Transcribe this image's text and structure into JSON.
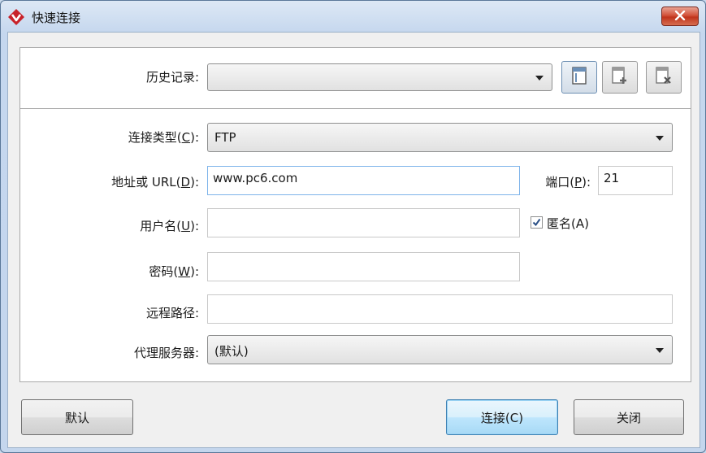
{
  "window": {
    "title": "快速连接",
    "icons": {
      "app": "app-logo-icon",
      "close": "close-icon"
    }
  },
  "history": {
    "label": "历史记录:",
    "value": "",
    "toolbar": {
      "icons": [
        "history-panel-icon",
        "add-history-icon",
        "delete-history-icon"
      ]
    }
  },
  "form": {
    "conn_type": {
      "label_pre": "连接类型(",
      "key": "C",
      "label_post": "):",
      "value": "FTP"
    },
    "address": {
      "label_pre": "地址或 URL(",
      "key": "D",
      "label_post": "):",
      "value": "www.pc6.com"
    },
    "port": {
      "label_pre": "端口(",
      "key": "P",
      "label_post": "):",
      "value": "21"
    },
    "username": {
      "label_pre": "用户名(",
      "key": "U",
      "label_post": "):",
      "value": ""
    },
    "anonymous": {
      "label": "匿名(A)",
      "checked": true
    },
    "password": {
      "label_pre": "密码(",
      "key": "W",
      "label_post": "):",
      "value": ""
    },
    "remote_path": {
      "label": "远程路径:",
      "value": ""
    },
    "proxy": {
      "label": "代理服务器:",
      "value": "(默认)"
    }
  },
  "buttons": {
    "default_label": "默认",
    "connect_label": "连接(C)",
    "close_label": "关闭"
  },
  "colors": {
    "accent": "#3c7fb1",
    "close_button": "#c0341c",
    "logo": "#c8222a"
  }
}
